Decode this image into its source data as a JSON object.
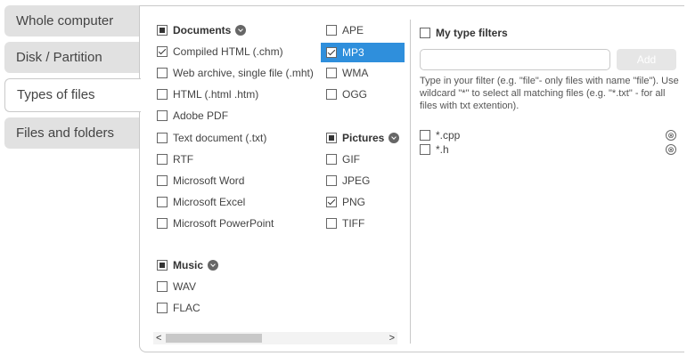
{
  "tabs": [
    {
      "label": "Whole computer"
    },
    {
      "label": "Disk / Partition"
    },
    {
      "label": "Types of files"
    },
    {
      "label": "Files and folders"
    }
  ],
  "documents": {
    "header": "Documents",
    "items": [
      {
        "label": "Compiled HTML (.chm)",
        "checked": true
      },
      {
        "label": "Web archive, single file (.mht)",
        "checked": false
      },
      {
        "label": "HTML (.html .htm)",
        "checked": false
      },
      {
        "label": "Adobe PDF",
        "checked": false
      },
      {
        "label": "Text document (.txt)",
        "checked": false
      },
      {
        "label": "RTF",
        "checked": false
      },
      {
        "label": "Microsoft Word",
        "checked": false
      },
      {
        "label": "Microsoft Excel",
        "checked": false
      },
      {
        "label": "Microsoft PowerPoint",
        "checked": false
      }
    ]
  },
  "music": {
    "header": "Music",
    "items": [
      {
        "label": "WAV",
        "checked": false
      },
      {
        "label": "FLAC",
        "checked": false
      }
    ]
  },
  "audio_col": {
    "items": [
      {
        "label": "APE",
        "checked": false
      },
      {
        "label": "MP3",
        "checked": true
      },
      {
        "label": "WMA",
        "checked": false
      },
      {
        "label": "OGG",
        "checked": false
      }
    ]
  },
  "pictures": {
    "header": "Pictures",
    "items": [
      {
        "label": "GIF",
        "checked": false
      },
      {
        "label": "JPEG",
        "checked": false
      },
      {
        "label": "PNG",
        "checked": true
      },
      {
        "label": "TIFF",
        "checked": false
      }
    ]
  },
  "my_filters": {
    "header": "My type filters",
    "input_value": "",
    "add_label": "Add",
    "help": "Type in your filter (e.g. \"file\"- only files with name \"file\"). Use wildcard \"*\" to select all matching files (e.g. \"*.txt\" - for all files with txt extention).",
    "filters": [
      {
        "label": "*.cpp",
        "checked": false
      },
      {
        "label": "*.h",
        "checked": false
      }
    ]
  },
  "scroll": {
    "left": "<",
    "right": ">"
  },
  "icons": {
    "remove": "⊗"
  }
}
